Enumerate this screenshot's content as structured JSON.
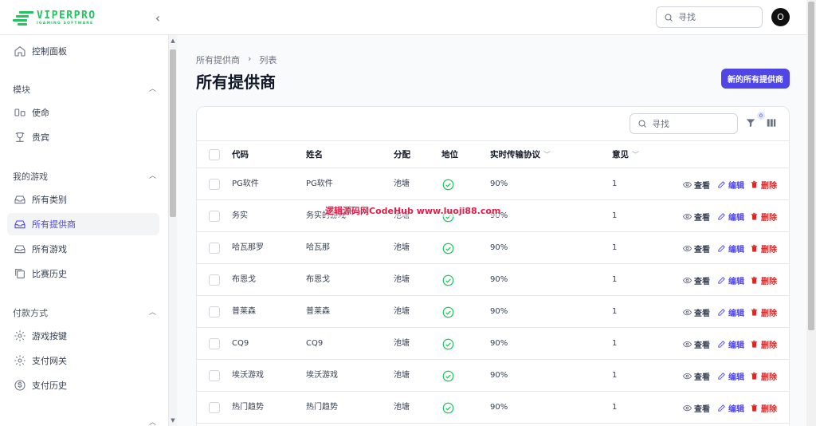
{
  "app": {
    "logo_title": "VIPERPRO",
    "logo_subtitle": "IGAMING SOFTWARE",
    "accent_color": "#4f46e5",
    "brand_color": "#22c55e"
  },
  "topbar": {
    "search_placeholder": "寻找",
    "avatar_initial": "O"
  },
  "sidebar": {
    "dashboard": {
      "label": "控制面板",
      "icon": "home-icon"
    },
    "sections": [
      {
        "label": "模块",
        "items": [
          {
            "label": "使命",
            "icon": "mission-icon"
          },
          {
            "label": "贵宾",
            "icon": "trophy-icon"
          }
        ]
      },
      {
        "label": "我的游戏",
        "items": [
          {
            "label": "所有类别",
            "icon": "inbox-icon"
          },
          {
            "label": "所有提供商",
            "icon": "inbox-icon",
            "active": true
          },
          {
            "label": "所有游戏",
            "icon": "inbox-icon"
          },
          {
            "label": "比赛历史",
            "icon": "copy-icon"
          }
        ]
      },
      {
        "label": "付款方式",
        "items": [
          {
            "label": "游戏按键",
            "icon": "gear-icon"
          },
          {
            "label": "支付网关",
            "icon": "gear-icon"
          },
          {
            "label": "支付历史",
            "icon": "dollar-icon"
          }
        ]
      }
    ]
  },
  "main": {
    "breadcrumb": [
      "所有提供商",
      "列表"
    ],
    "title": "所有提供商",
    "new_button": "新的所有提供商",
    "table": {
      "search_placeholder": "寻找",
      "filter_count": "0",
      "columns": {
        "code": "代码",
        "name": "姓名",
        "distribution": "分配",
        "status": "地位",
        "rtp": "实时传输协议",
        "views": "意见"
      },
      "actions": {
        "view": "查看",
        "edit": "编辑",
        "delete": "删除"
      },
      "rows": [
        {
          "code": "PG软件",
          "name": "PG软件",
          "distribution": "池塘",
          "rtp": "90%",
          "views": "1"
        },
        {
          "code": "务实",
          "name": "务实的游戏",
          "distribution": "池塘",
          "rtp": "90%",
          "views": "1"
        },
        {
          "code": "哈瓦那罗",
          "name": "哈瓦那",
          "distribution": "池塘",
          "rtp": "90%",
          "views": "1"
        },
        {
          "code": "布恩戈",
          "name": "布恩戈",
          "distribution": "池塘",
          "rtp": "90%",
          "views": "1"
        },
        {
          "code": "普莱森",
          "name": "普莱森",
          "distribution": "池塘",
          "rtp": "90%",
          "views": "1"
        },
        {
          "code": "CQ9",
          "name": "CQ9",
          "distribution": "池塘",
          "rtp": "90%",
          "views": "1"
        },
        {
          "code": "埃沃游戏",
          "name": "埃沃游戏",
          "distribution": "池塘",
          "rtp": "90%",
          "views": "1"
        },
        {
          "code": "热门趋势",
          "name": "热门趋势",
          "distribution": "池塘",
          "rtp": "90%",
          "views": "1"
        }
      ]
    }
  },
  "watermark": "逻辑源码网CodeHub www.luoji88.com"
}
